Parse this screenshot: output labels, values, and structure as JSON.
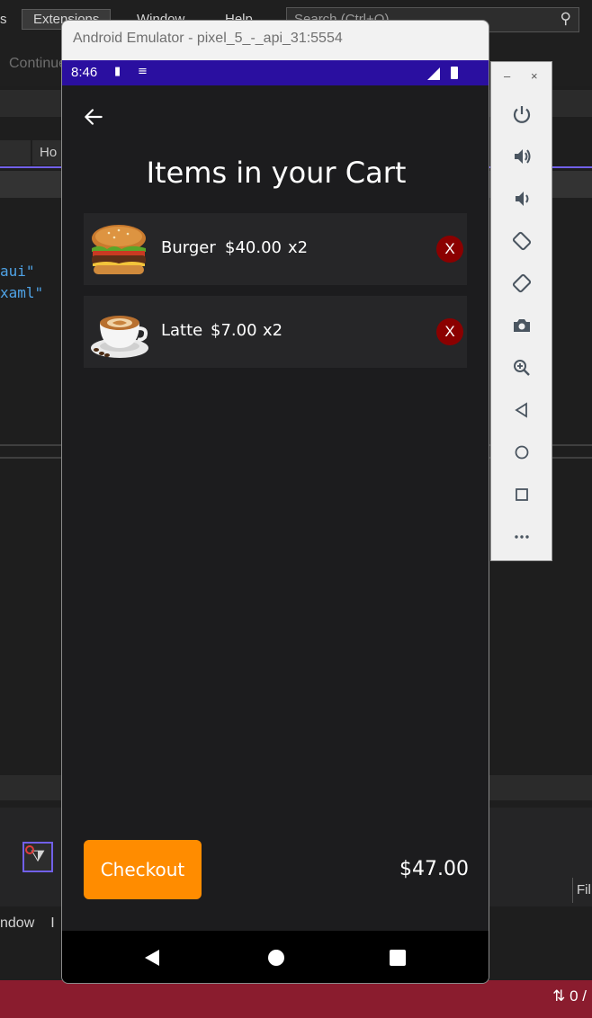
{
  "ide": {
    "menu": [
      "s",
      "Extensions",
      "Window",
      "Help"
    ],
    "search_placeholder": "Search (Ctrl+Q)",
    "continue_label": "Continue",
    "tab_label": "Ho",
    "code_lines": [
      "aui\"",
      "xaml\""
    ],
    "bottom_fragment": "ndow",
    "bottom_fragment2": "I",
    "fi_label": "Fil",
    "status_text": "⇅ 0 /"
  },
  "emulator": {
    "title": "Android Emulator - pixel_5_-_api_31:5554",
    "toolbar": {
      "minimize": "–",
      "close": "×",
      "tools": [
        "power-icon",
        "volume-up-icon",
        "volume-down-icon",
        "rotate-left-icon",
        "rotate-right-icon",
        "camera-icon",
        "zoom-icon",
        "back-icon",
        "home-icon",
        "overview-icon",
        "more-icon"
      ]
    }
  },
  "phone": {
    "status": {
      "time": "8:46"
    },
    "page_title": "Items in your Cart",
    "items": [
      {
        "name": "Burger",
        "price": "$40.00",
        "qty": "x2",
        "remove": "X"
      },
      {
        "name": "Latte",
        "price": "$7.00",
        "qty": "x2",
        "remove": "X"
      }
    ],
    "checkout_label": "Checkout",
    "total": "$47.00",
    "colors": {
      "accent": "#ff8c00",
      "remove": "#8b0000",
      "statusbar": "#2a0fa0"
    }
  }
}
